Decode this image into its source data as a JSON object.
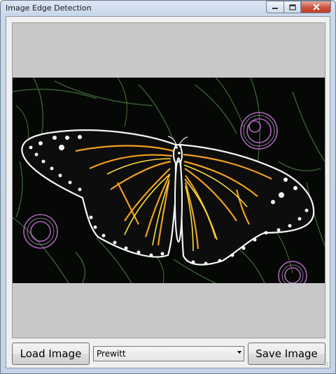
{
  "window": {
    "title": "Image Edge Detection",
    "controls": [
      "minimize-icon",
      "maximize-icon",
      "close-icon"
    ]
  },
  "toolbar": {
    "load_label": "Load Image",
    "save_label": "Save Image",
    "filter": {
      "selected": "Prewitt"
    }
  },
  "image": {
    "description_icon": "edge-detected-butterfly-image"
  },
  "colors": {
    "picture_background": "#c8c8c8",
    "edge_background": "#050805",
    "wing_edge_orange": "#f0a020",
    "wing_edge_yellow": "#f8e040",
    "vein_white": "#f5f5f5",
    "flower_purple": "#b060c0"
  }
}
